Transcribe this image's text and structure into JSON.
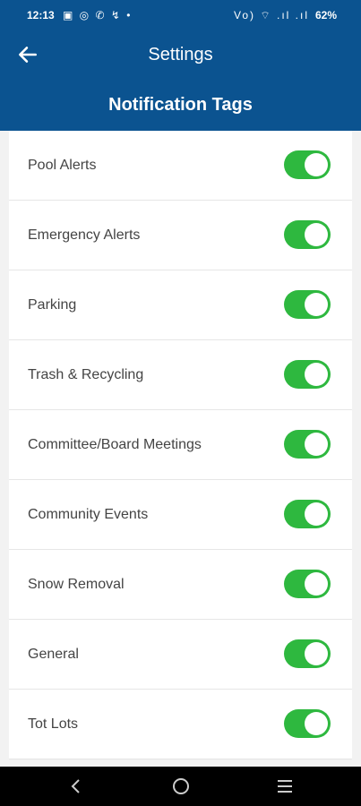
{
  "status_bar": {
    "time": "12:13",
    "left_icons": "▣ ◎ ✆ ↯ •",
    "right_icons": "Vo) ⌔ .ıl .ıl",
    "battery": "62%"
  },
  "header": {
    "title": "Settings",
    "section_title": "Notification Tags"
  },
  "accent_color": "#2eb83f",
  "header_color": "#0b5390",
  "tags": [
    {
      "label": "Pool Alerts",
      "enabled": true
    },
    {
      "label": "Emergency Alerts",
      "enabled": true
    },
    {
      "label": "Parking",
      "enabled": true
    },
    {
      "label": "Trash & Recycling",
      "enabled": true
    },
    {
      "label": "Committee/Board Meetings",
      "enabled": true
    },
    {
      "label": "Community Events",
      "enabled": true
    },
    {
      "label": "Snow Removal",
      "enabled": true
    },
    {
      "label": "General",
      "enabled": true
    },
    {
      "label": "Tot Lots",
      "enabled": true
    }
  ]
}
